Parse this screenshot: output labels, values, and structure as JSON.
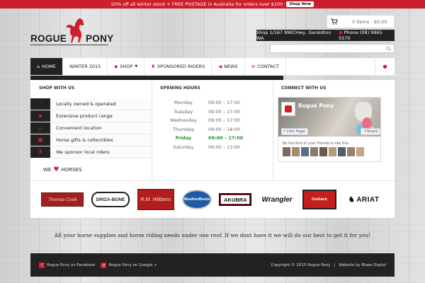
{
  "promo": {
    "text": "50% off all winter stock + FREE POSTAGE in Australia for orders over $100",
    "button_label": "Shop Now"
  },
  "logo": {
    "text_left": "ROGUE",
    "text_right": "PONY",
    "icon": "rearing-horse-icon"
  },
  "cart": {
    "icon": "cart-icon",
    "label": "0 items - $0.00"
  },
  "contact": {
    "address": "Shop 1/167 NWCHwy, Geraldton WA",
    "phone": "Phone (08) 9965 5570"
  },
  "search": {
    "placeholder": "",
    "icon": "search-icon"
  },
  "nav": {
    "items": [
      {
        "label": "Home",
        "icon": "home-icon"
      },
      {
        "label": "Winter 2015",
        "icon": ""
      },
      {
        "label": "Shop",
        "icon": "tag-icon"
      },
      {
        "label": "Sponsored Riders",
        "icon": "trophy-icon"
      },
      {
        "label": "News",
        "icon": "megaphone-icon"
      },
      {
        "label": "Contact",
        "icon": "envelope-icon"
      }
    ],
    "user_icon": "user-icon"
  },
  "shop_with_us": {
    "heading": "Shop with us",
    "items": [
      {
        "label": "Locally owned & operated",
        "icon": "info-icon"
      },
      {
        "label": "Extensive product range",
        "icon": "tag-icon"
      },
      {
        "label": "Convenient location",
        "icon": "home-icon"
      },
      {
        "label": "Horse gifts & collectibles",
        "icon": "gift-icon"
      },
      {
        "label": "We sponsor local riders",
        "icon": "trophy-icon"
      }
    ],
    "we_love": {
      "we": "WE",
      "horses": "HORSES"
    }
  },
  "opening_hours": {
    "heading": "Opening hours",
    "rows": [
      {
        "day": "Monday",
        "time": "09:00 – 17:00"
      },
      {
        "day": "Tuesday",
        "time": "09:00 – 17:00"
      },
      {
        "day": "Wednesday",
        "time": "09:00 – 17:00"
      },
      {
        "day": "Thursday",
        "time": "09:00 – 18:00"
      },
      {
        "day": "Friday",
        "time": "09:00 – 17:00"
      },
      {
        "day": "Saturday",
        "time": "09:00 – 13:00"
      }
    ],
    "today_color": "#2e8b2e"
  },
  "connect": {
    "heading": "Connect with us",
    "page_name": "Rogue Pony",
    "like_label": "Like Page",
    "share_label": "Share",
    "friends_text": "Be the first of your friends to like this"
  },
  "brands": [
    {
      "name": "Thomas Cook"
    },
    {
      "name": "DRIZA-BONE"
    },
    {
      "name": "R.M. Williams"
    },
    {
      "name": "WeatherBeeta"
    },
    {
      "name": "AKUBRA"
    },
    {
      "name": "Wrangler"
    },
    {
      "name": "Outback"
    },
    {
      "name": "ARIAT"
    }
  ],
  "tagline": "All your horse supplies and horse riding needs under one roof. If we dont have it we will do our best to get it for you!",
  "footer": {
    "facebook_label": "Rogue Pony on Facebook",
    "google_label": "Rogue Pony on Google +",
    "copyright": "Copyright © 2015 Rogue Pony",
    "separator": "|",
    "credit": "Website by Blaze Digital"
  },
  "colors": {
    "accent": "#cc1f2b",
    "dark": "#222222"
  }
}
